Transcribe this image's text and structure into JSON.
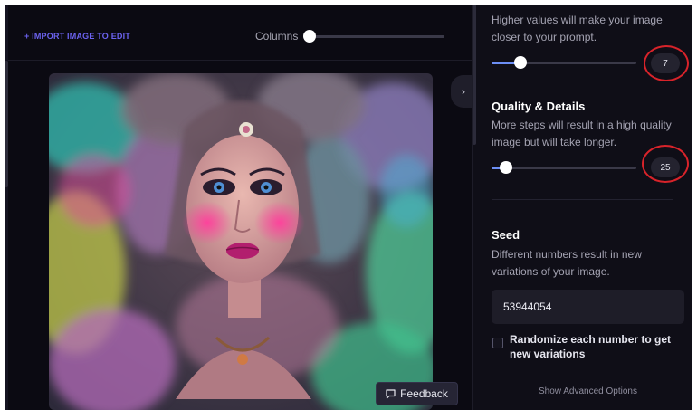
{
  "toolbar": {
    "import_label": "+ IMPORT IMAGE TO EDIT",
    "columns_label": "Columns"
  },
  "feedback": {
    "label": "Feedback"
  },
  "guidance": {
    "description": "Higher values will make your image closer to your prompt.",
    "value": "7",
    "level": 0.2
  },
  "quality": {
    "title": "Quality & Details",
    "description": "More steps will result in a high quality image but will take longer.",
    "value": "25",
    "level": 0.1
  },
  "seed": {
    "title": "Seed",
    "description": "Different numbers result in new variations of your image.",
    "value": "53944054"
  },
  "randomize": {
    "label": "Randomize each number to get new variations",
    "checked": false
  },
  "advanced": {
    "label": "Show Advanced Options"
  },
  "colors": {
    "accent": "#6c63f0",
    "slider_fill": "#6c8ef5",
    "highlight_ring": "#d8232a",
    "background": "#0b0a12"
  },
  "icons": {
    "next": "chevron-right-icon",
    "feedback": "chat-bubble-icon"
  }
}
